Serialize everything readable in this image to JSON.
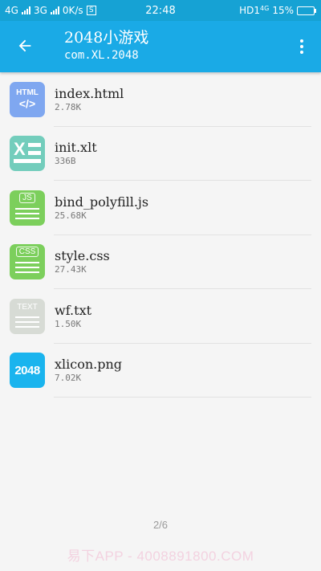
{
  "status_bar": {
    "left_net1": "4G",
    "left_net2": "3G",
    "speed": "0K/s",
    "s_icon": "S",
    "time": "22:48",
    "hd": "HD1",
    "net_small": "4G",
    "battery_text": "15%",
    "battery_level": 0.15
  },
  "app_bar": {
    "title": "2048小游戏",
    "subtitle": "com.XL.2048",
    "back_icon": "arrow-back-icon",
    "more_icon": "more-vert-icon"
  },
  "files": [
    {
      "name": "index.html",
      "size": "2.78K",
      "icon_label": "HTML",
      "icon_code": "</>"
    },
    {
      "name": "init.xlt",
      "size": "336B",
      "icon_label": "X"
    },
    {
      "name": "bind_polyfill.js",
      "size": "25.68K",
      "icon_label": "JS"
    },
    {
      "name": "style.css",
      "size": "27.43K",
      "icon_label": "CSS"
    },
    {
      "name": "wf.txt",
      "size": "1.50K",
      "icon_label": "TEXT"
    },
    {
      "name": "xlicon.png",
      "size": "7.02K",
      "icon_label": "2048"
    }
  ],
  "page_indicator": "2/6",
  "watermark": "易下APP - 4008891800.COM",
  "colors": {
    "status_bar": "#16a2d4",
    "app_bar": "#1aaae6",
    "html_icon": "#7fa7f0",
    "xlt_icon": "#73cdbc",
    "js_icon": "#7ccf5c",
    "css_icon": "#7ccf5c",
    "txt_icon": "#d7dbd5",
    "png_icon": "#1ab4ee"
  }
}
